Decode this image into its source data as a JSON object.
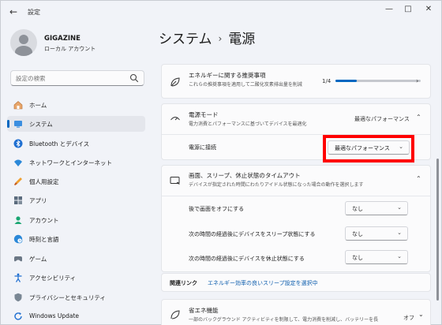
{
  "window": {
    "title": "設定",
    "controls": {
      "minimize": "—",
      "maximize": "□",
      "close": "✕"
    }
  },
  "user": {
    "name": "GIGAZINE",
    "account_type": "ローカル アカウント"
  },
  "search": {
    "placeholder": "設定の検索"
  },
  "sidebar": {
    "items": [
      {
        "label": "ホーム",
        "icon": "home-icon"
      },
      {
        "label": "システム",
        "icon": "system-icon",
        "active": true
      },
      {
        "label": "Bluetooth とデバイス",
        "icon": "bluetooth-icon"
      },
      {
        "label": "ネットワークとインターネット",
        "icon": "wifi-icon"
      },
      {
        "label": "個人用設定",
        "icon": "brush-icon"
      },
      {
        "label": "アプリ",
        "icon": "apps-icon"
      },
      {
        "label": "アカウント",
        "icon": "account-icon"
      },
      {
        "label": "時刻と言語",
        "icon": "globe-clock-icon"
      },
      {
        "label": "ゲーム",
        "icon": "game-icon"
      },
      {
        "label": "アクセシビリティ",
        "icon": "accessibility-icon"
      },
      {
        "label": "プライバシーとセキュリティ",
        "icon": "shield-icon"
      },
      {
        "label": "Windows Update",
        "icon": "update-icon"
      }
    ]
  },
  "breadcrumb": {
    "parent": "システム",
    "separator": "›",
    "current": "電源"
  },
  "energy_card": {
    "title": "エネルギーに関する推奨事項",
    "subtitle": "これらの推奨事項を適用して二酸化炭素排出量を削減",
    "progress_text": "1/4",
    "progress_fraction": 0.25
  },
  "power_mode_card": {
    "title": "電源モード",
    "subtitle": "電力消費とパフォーマンスに基づいてデバイスを最適化",
    "value": "最適なパフォーマンス",
    "row_label": "電源に接続",
    "dropdown_value": "最適なパフォーマンス"
  },
  "screen_sleep_card": {
    "title": "画面、スリープ、休止状態のタイムアウト",
    "subtitle": "デバイスが指定された時間にわたりアイドル状態になった場合の動作を選択します",
    "rows": [
      {
        "label": "後で画面をオフにする",
        "value": "なし"
      },
      {
        "label": "次の時間の経過後にデバイスをスリープ状態にする",
        "value": "なし"
      },
      {
        "label": "次の時間の経過後にデバイスを休止状態にする",
        "value": "なし"
      }
    ]
  },
  "related_links": {
    "label": "関連リンク",
    "link_text": "エネルギー効率の良いスリープ設定を選択中"
  },
  "battery_saver_card": {
    "title": "省エネ機能",
    "subtitle": "一部のバックグラウンド アクティビティを制限して、電力消費を削減し、バッテリーを長",
    "value": "オフ"
  },
  "colors": {
    "accent": "#0067c0",
    "highlight": "#ff0000"
  }
}
